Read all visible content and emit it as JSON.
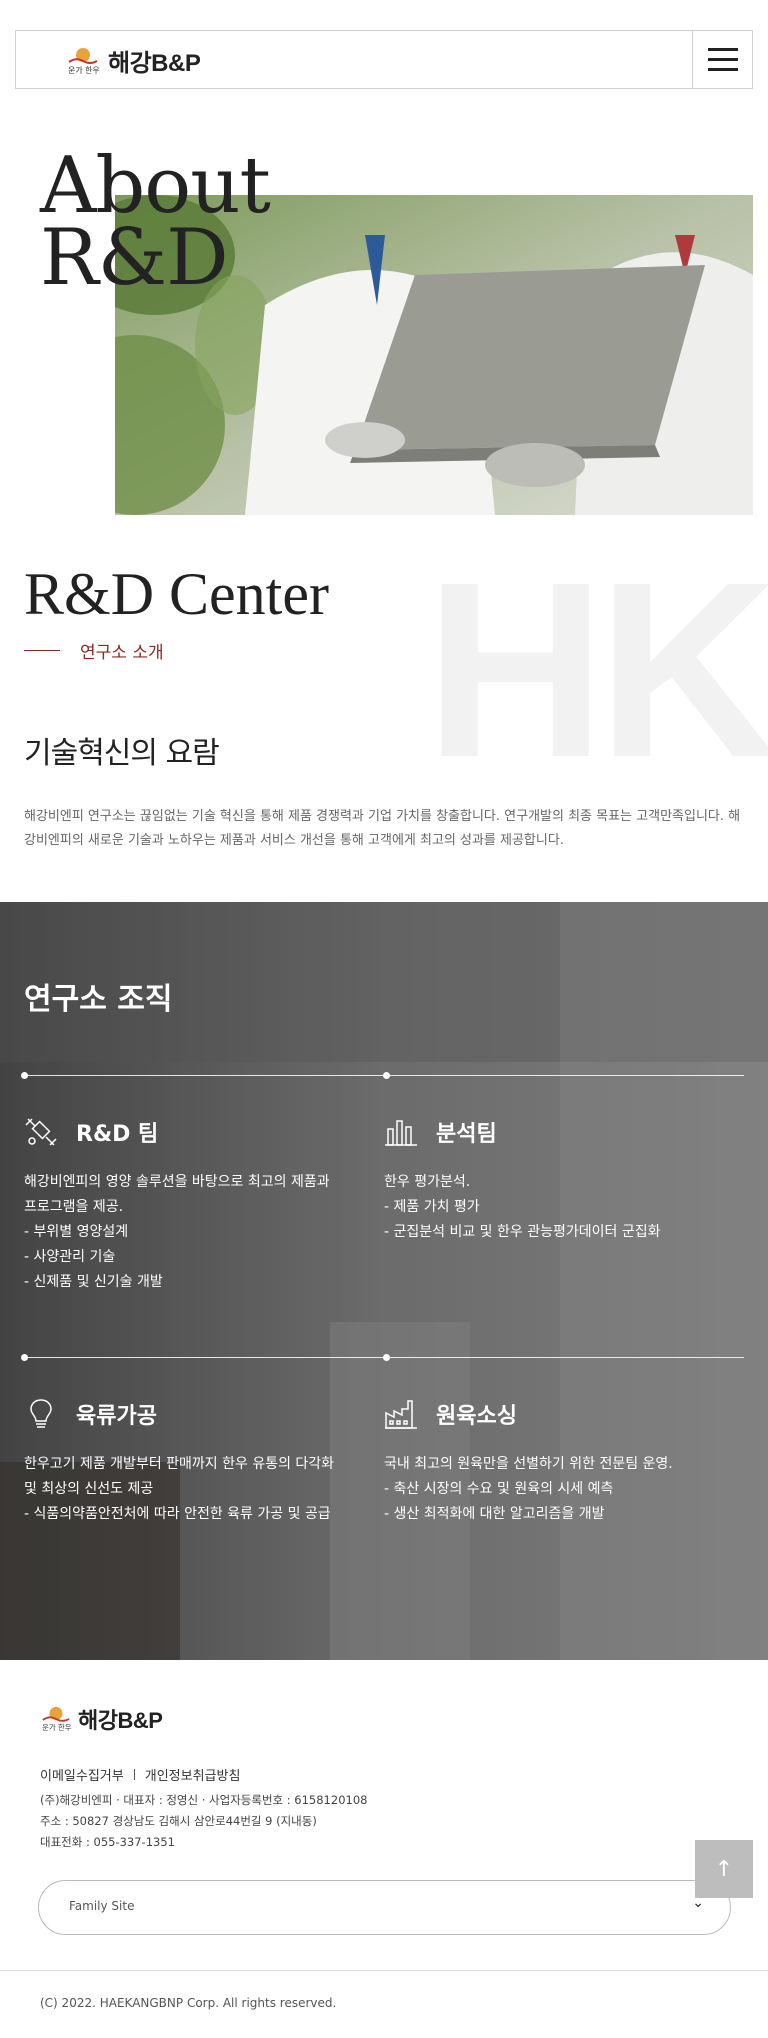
{
  "header": {
    "logo_text": "해강B&P",
    "menu_icon": "hamburger-menu-icon"
  },
  "hero": {
    "title_line1": "About",
    "title_line2": "R&D"
  },
  "center": {
    "watermark": "HK",
    "title": "R&D Center",
    "subtitle": "연구소 소개",
    "headline": "기술혁신의 요람",
    "intro": "해강비엔피 연구소는 끊임없는 기술 혁신을 통해 제품 경쟁력과 기업 가치를 창출합니다. 연구개발의 최종 목표는 고객만족입니다. 해강비엔피의 새로운 기술과 노하우는 제품과 서비스 개선을 통해 고객에게 최고의 성과를 제공합니다."
  },
  "org": {
    "title": "연구소 조직",
    "teams": [
      {
        "name": "R&D 팀",
        "icon": "satellite-icon",
        "lines": [
          "해강비엔피의 영양 솔루션을 바탕으로 최고의 제품과",
          "프로그램을 제공.",
          "- 부위별 영양설계",
          "- 사양관리 기술",
          "- 신제품 및 신기술 개발"
        ]
      },
      {
        "name": "분석팀",
        "icon": "bar-chart-icon",
        "lines": [
          "한우 평가분석.",
          "- 제품 가치 평가",
          "- 군집분석 비교 및 한우 관능평가데이터 군집화"
        ]
      },
      {
        "name": "육류가공",
        "icon": "lightbulb-icon",
        "lines": [
          "한우고기 제품 개발부터 판매까지 한우 유통의 다각화",
          "및 최상의 신선도 제공",
          "- 식품의약품안전처에 따라 안전한 육류 가공 및 공급"
        ]
      },
      {
        "name": "원육소싱",
        "icon": "factory-icon",
        "lines": [
          "국내 최고의 원육만을 선별하기 위한 전문팀 운영.",
          "- 축산 시장의 수요 및 원육의 시세 예측",
          "- 생산 최적화에 대한 알고리즘을 개발"
        ]
      }
    ]
  },
  "footer": {
    "logo_text": "해강B&P",
    "link_1": "이메일수집거부",
    "link_2": "개인정보취급방침",
    "info_1": "(주)해강비엔피 · 대표자 : 정영신 · 사업자등록번호 : 6158120108",
    "info_2": "주소 : 50827 경상남도 김해시 삼안로44번길 9 (지내동)",
    "info_3": "대표전화 : 055-337-1351",
    "family_site": "Family Site",
    "family_chevron": "chevron-down-icon",
    "top_arrow": "↑",
    "copyright": "(C) 2022. HAEKANGBNP Corp. All rights reserved."
  }
}
